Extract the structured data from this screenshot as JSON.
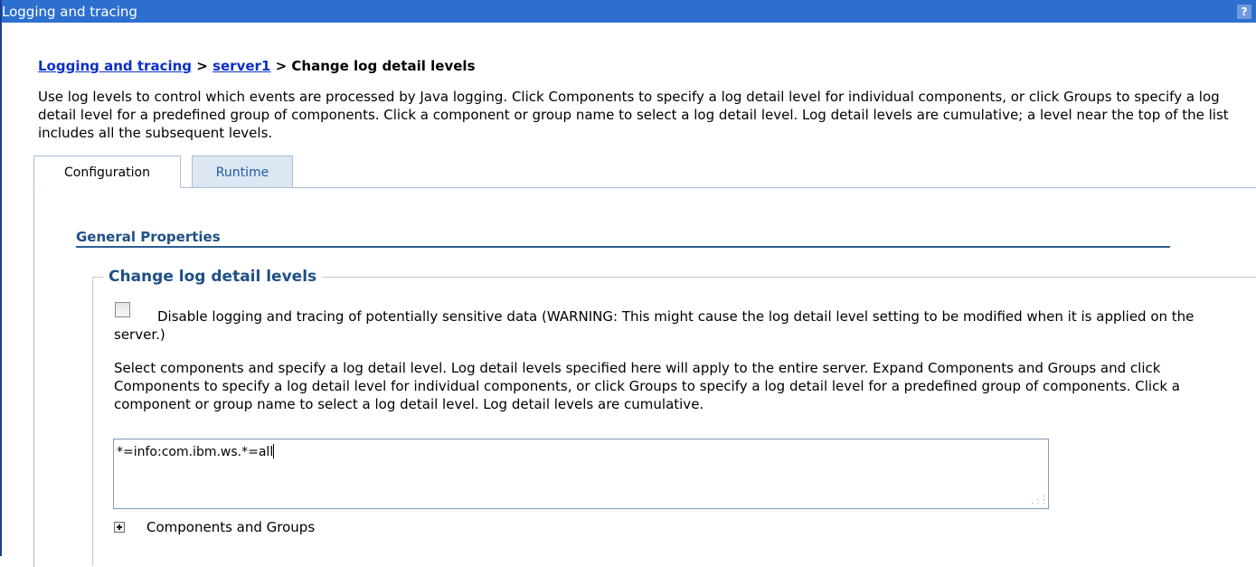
{
  "window": {
    "title": "Logging and tracing",
    "help_label": "?"
  },
  "breadcrumb": {
    "items": [
      "Logging and tracing",
      "server1"
    ],
    "separator": ">",
    "current": "Change log detail levels"
  },
  "intro_text": "Use log levels to control which events are processed by Java logging. Click Components to specify a log detail level for individual components, or click Groups to specify a log detail level for a predefined group of components. Click a component or group name to select a log detail level. Log detail levels are cumulative; a level near the top of the list includes all the subsequent levels.",
  "tabs": [
    {
      "label": "Configuration",
      "active": true
    },
    {
      "label": "Runtime",
      "active": false
    }
  ],
  "general_properties": {
    "title": "General Properties"
  },
  "section": {
    "legend": "Change log detail levels",
    "checkbox_label": "Disable logging and tracing of potentially sensitive data (WARNING: This might cause the log detail level setting to be modified when it is applied on the server.)",
    "checkbox_checked": false,
    "description": "Select components and specify a log detail level. Log detail levels specified here will apply to the entire server. Expand Components and Groups and click Components to specify a log detail level for individual components, or click Groups to specify a log detail level for a predefined group of components. Click a component or group name to select a log detail level. Log detail levels are cumulative.",
    "textarea_value": "*=info:com.ibm.ws.*=all",
    "expander_label": "Components and Groups",
    "expander_icon": "plus-icon"
  },
  "colors": {
    "titlebar": "#2d6fcf",
    "link": "#0b30c6",
    "heading": "#1f4f86",
    "tab_inactive_bg": "#dde7f4"
  }
}
